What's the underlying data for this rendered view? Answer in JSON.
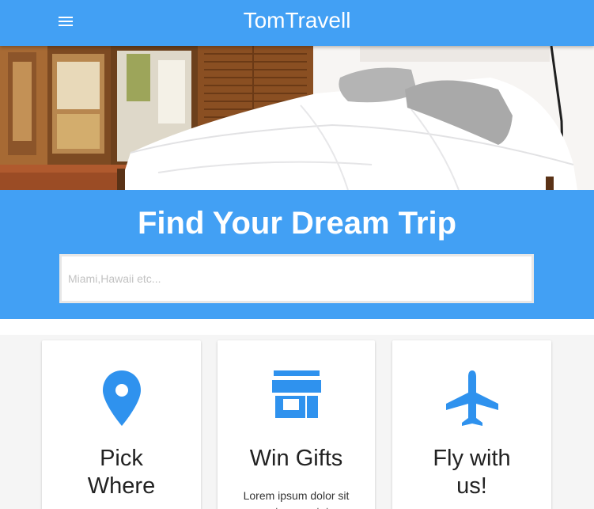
{
  "navbar": {
    "brand": "TomTravell",
    "menu_icon": "menu-icon"
  },
  "hero": {
    "alt": "bedroom-photo"
  },
  "search": {
    "title": "Find Your Dream Trip",
    "placeholder": "Miami,Hawaii etc..."
  },
  "colors": {
    "primary": "#42a0f4",
    "icon": "#2f92ee",
    "background": "#f5f5f5"
  },
  "features": [
    {
      "icon": "location-pin-icon",
      "title": "Pick Where",
      "text": ""
    },
    {
      "icon": "store-icon",
      "title": "Win Gifts",
      "text": "Lorem ipsum dolor sit amet consectetur"
    },
    {
      "icon": "airplane-icon",
      "title": "Fly with us!",
      "text": ""
    }
  ]
}
